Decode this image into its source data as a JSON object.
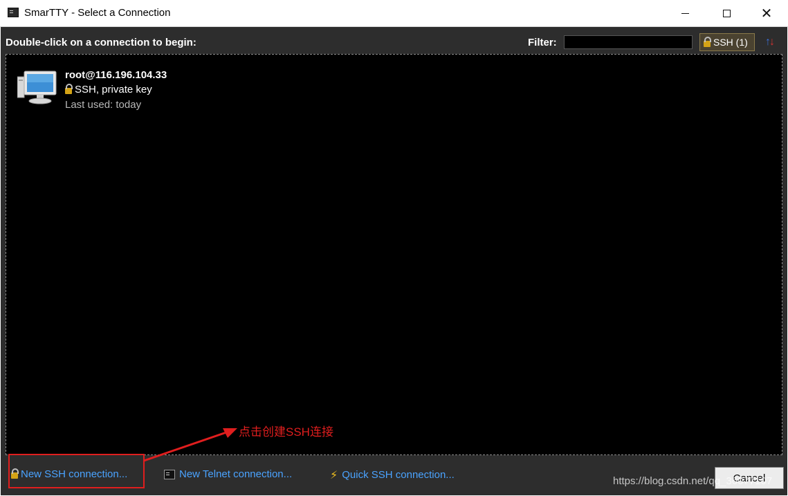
{
  "window": {
    "title": "SmarTTY - Select a Connection",
    "controls": {
      "minimize": "minimize",
      "maximize": "maximize",
      "close": "✕"
    }
  },
  "header": {
    "instruction": "Double-click on a connection to begin:",
    "filter_label": "Filter:",
    "filter_value": "",
    "ssh_toggle": "SSH (1)"
  },
  "connections": [
    {
      "host": "root@116.196.104.33",
      "type": "SSH, private key",
      "last_used": "Last used: today",
      "icon": "computer-icon"
    }
  ],
  "annotation": {
    "text": "点击创建SSH连接",
    "color": "#e01e1e"
  },
  "footer": {
    "new_ssh": "New SSH connection...",
    "new_telnet": "New Telnet connection...",
    "quick_ssh": "Quick SSH connection...",
    "cancel": "Cancel",
    "watermark": "https://blog.csdn.net/qq_36077107"
  },
  "colors": {
    "background": "#2d2d2d",
    "list_bg": "#000000",
    "link": "#4aa3ff",
    "accent_lock": "#d4a316"
  }
}
